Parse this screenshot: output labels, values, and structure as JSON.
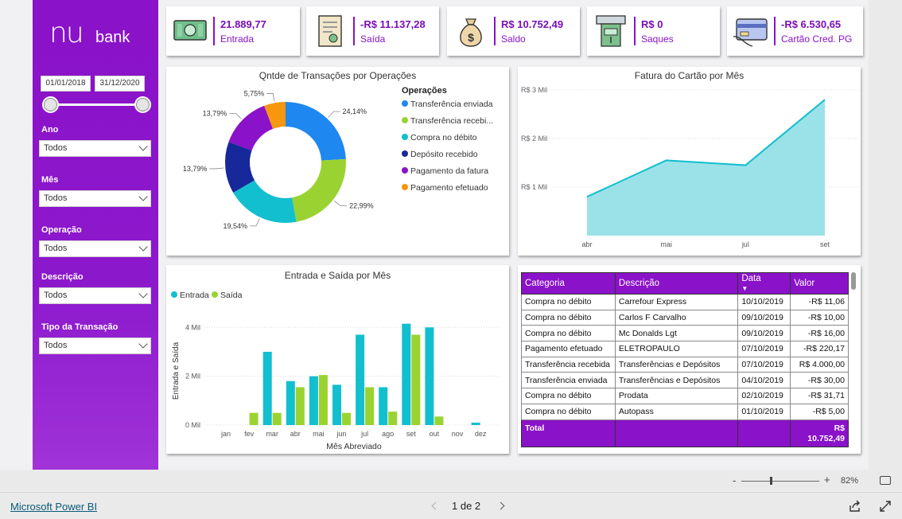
{
  "app": {
    "name": "Microsoft Power BI",
    "brand_color": "#8a12c8"
  },
  "logo": {
    "part1": "nu",
    "part2": "bank"
  },
  "filters": {
    "date_start": "01/01/2018",
    "date_end": "31/12/2020",
    "items": [
      {
        "label": "Ano",
        "value": "Todos"
      },
      {
        "label": "Mês",
        "value": "Todos"
      },
      {
        "label": "Operação",
        "value": "Todos"
      },
      {
        "label": "Descrição",
        "value": "Todos"
      },
      {
        "label": "Tipo da Transação",
        "value": "Todos"
      }
    ]
  },
  "kpis": [
    {
      "value": "21.889,77",
      "label": "Entrada",
      "icon": "money-icon"
    },
    {
      "value": "-R$ 11.137,28",
      "label": "Saída",
      "icon": "receipt-icon"
    },
    {
      "value": "R$ 10.752,49",
      "label": "Saldo",
      "icon": "money-bag-icon"
    },
    {
      "value": "R$ 0",
      "label": "Saques",
      "icon": "atm-icon"
    },
    {
      "value": "-R$ 6.530,65",
      "label": "Cartão Cred. PG",
      "icon": "credit-card-icon"
    }
  ],
  "donut": {
    "title": "Qntde de Transações por Operações",
    "legend_title": "Operações",
    "chart_data": {
      "type": "pie",
      "title": "Qntde de Transações por Operações",
      "slices": [
        {
          "name": "Transferência enviada",
          "display_name": "Transferência enviada",
          "value": 24.14,
          "label": "24,14%",
          "color": "#1e88f0"
        },
        {
          "name": "Transferência recebida",
          "display_name": "Transferência recebi...",
          "value": 22.99,
          "label": "22,99%",
          "color": "#9ad331"
        },
        {
          "name": "Compra no débito",
          "display_name": "Compra no débito",
          "value": 19.54,
          "label": "19,54%",
          "color": "#12bfcf"
        },
        {
          "name": "Depósito recebido",
          "display_name": "Depósito recebido",
          "value": 13.79,
          "label": "13,79%",
          "color": "#17289a"
        },
        {
          "name": "Pagamento da fatura",
          "display_name": "Pagamento da fatura",
          "value": 13.79,
          "label": "13,79%",
          "color": "#8a12c8"
        },
        {
          "name": "Pagamento efetuado",
          "display_name": "Pagamento efetuado",
          "value": 5.75,
          "label": "5,75%",
          "color": "#f7960f"
        }
      ]
    }
  },
  "area": {
    "title": "Fatura do Cartão por Mês",
    "chart_data": {
      "type": "area",
      "title": "Fatura do Cartão por Mês",
      "categories": [
        "abr",
        "mai",
        "jul",
        "set"
      ],
      "values": [
        800,
        1550,
        1450,
        2800
      ],
      "y_ticks": [
        {
          "value": 1000,
          "label": "R$ 1 Mil"
        },
        {
          "value": 2000,
          "label": "R$ 2 Mil"
        },
        {
          "value": 3000,
          "label": "R$ 3 Mil"
        }
      ],
      "ylim": [
        0,
        3000
      ],
      "fill_color": "#9be2e8",
      "line_color": "#12bfcf"
    }
  },
  "bars": {
    "title": "Entrada e Saída por Mês",
    "chart_data": {
      "type": "bar",
      "title": "Entrada e Saída por Mês",
      "xlabel": "Mês Abreviado",
      "ylabel": "Entrada e Saída",
      "categories": [
        "jan",
        "fev",
        "mar",
        "abr",
        "mai",
        "jun",
        "jul",
        "ago",
        "set",
        "out",
        "nov",
        "dez"
      ],
      "series": [
        {
          "name": "Entrada",
          "color": "#12bfcf",
          "values": [
            0,
            0,
            3000,
            1800,
            2000,
            1650,
            3700,
            1550,
            4150,
            4000,
            0,
            100
          ]
        },
        {
          "name": "Saída",
          "color": "#9ad331",
          "values": [
            0,
            500,
            500,
            1550,
            2050,
            500,
            1550,
            550,
            3700,
            350,
            0,
            0
          ]
        }
      ],
      "y_ticks": [
        {
          "value": 0,
          "label": "0 Mil"
        },
        {
          "value": 2000,
          "label": "2 Mil"
        },
        {
          "value": 4000,
          "label": "4 Mil"
        }
      ],
      "ylim": [
        0,
        4400
      ],
      "grid": true,
      "legend": "top-left"
    }
  },
  "table": {
    "headers": [
      "Categoria",
      "Descrição",
      "Data",
      "Valor"
    ],
    "rows": [
      [
        "Compra no débito",
        "Carrefour Express",
        "10/10/2019",
        "-R$ 11,06"
      ],
      [
        "Compra no débito",
        "Carlos F Carvalho",
        "09/10/2019",
        "-R$ 10,00"
      ],
      [
        "Compra no débito",
        "Mc Donalds Lgt",
        "09/10/2019",
        "-R$ 16,00"
      ],
      [
        "Pagamento efetuado",
        "ELETROPAULO",
        "07/10/2019",
        "-R$ 220,17"
      ],
      [
        "Transferência recebida",
        "Transferências e Depósitos",
        "07/10/2019",
        "R$ 4.000,00"
      ],
      [
        "Transferência enviada",
        "Transferências e Depósitos",
        "04/10/2019",
        "-R$ 30,00"
      ],
      [
        "Compra no débito",
        "Prodata",
        "02/10/2019",
        "-R$ 31,71"
      ],
      [
        "Compra no débito",
        "Autopass",
        "01/10/2019",
        "-R$ 5,00"
      ]
    ],
    "total_label": "Total",
    "total_value_line1": "R$",
    "total_value_line2": "10.752,49"
  },
  "zoom": {
    "level": "82%",
    "minus": "-",
    "plus": "+"
  },
  "pager": {
    "text": "1 de 2"
  }
}
